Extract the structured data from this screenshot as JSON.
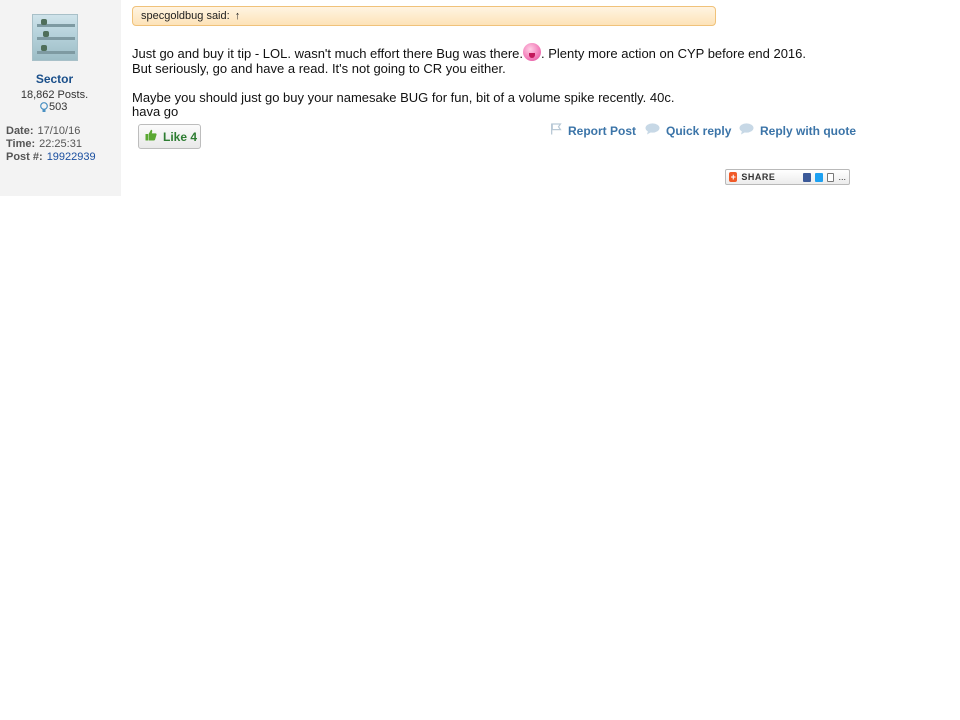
{
  "author": {
    "username": "Sector",
    "posts": "18,862 Posts.",
    "reputation": "503"
  },
  "post_meta": {
    "date_label": "Date:",
    "date_value": "17/10/16",
    "time_label": "Time:",
    "time_value": "22:25:31",
    "postnum_label": "Post #:",
    "postnum_value": "19922939"
  },
  "quote": {
    "text": "specgoldbug said:",
    "arrow": "↑"
  },
  "body": {
    "line1_a": "Just go and buy it tip - LOL. wasn't much effort there Bug was there.",
    "line1_b": ". Plenty more action on CYP before end 2016.",
    "line2": "But seriously, go and have a read. It's not going to CR you either.",
    "line3": "Maybe you should just go buy your namesake BUG for fun, bit of a volume spike recently. 40c.",
    "line4": "hava go"
  },
  "like": {
    "label": "Like 4"
  },
  "actions": {
    "report": "Report Post",
    "quick_reply": "Quick reply",
    "reply_quote": "Reply with quote"
  },
  "share": {
    "label": "SHARE",
    "more": "..."
  },
  "colors": {
    "link": "#3b74a8",
    "username": "#1a4f8a",
    "like_green": "#2e7d32",
    "quote_border": "#f0c27a"
  },
  "icons": [
    "avatar-image",
    "reputation-bulb-icon",
    "smiley-tongue-icon",
    "thumbs-up-icon",
    "flag-icon",
    "speech-bubble-icon",
    "share-plus-icon",
    "facebook-icon",
    "twitter-icon",
    "email-icon"
  ]
}
